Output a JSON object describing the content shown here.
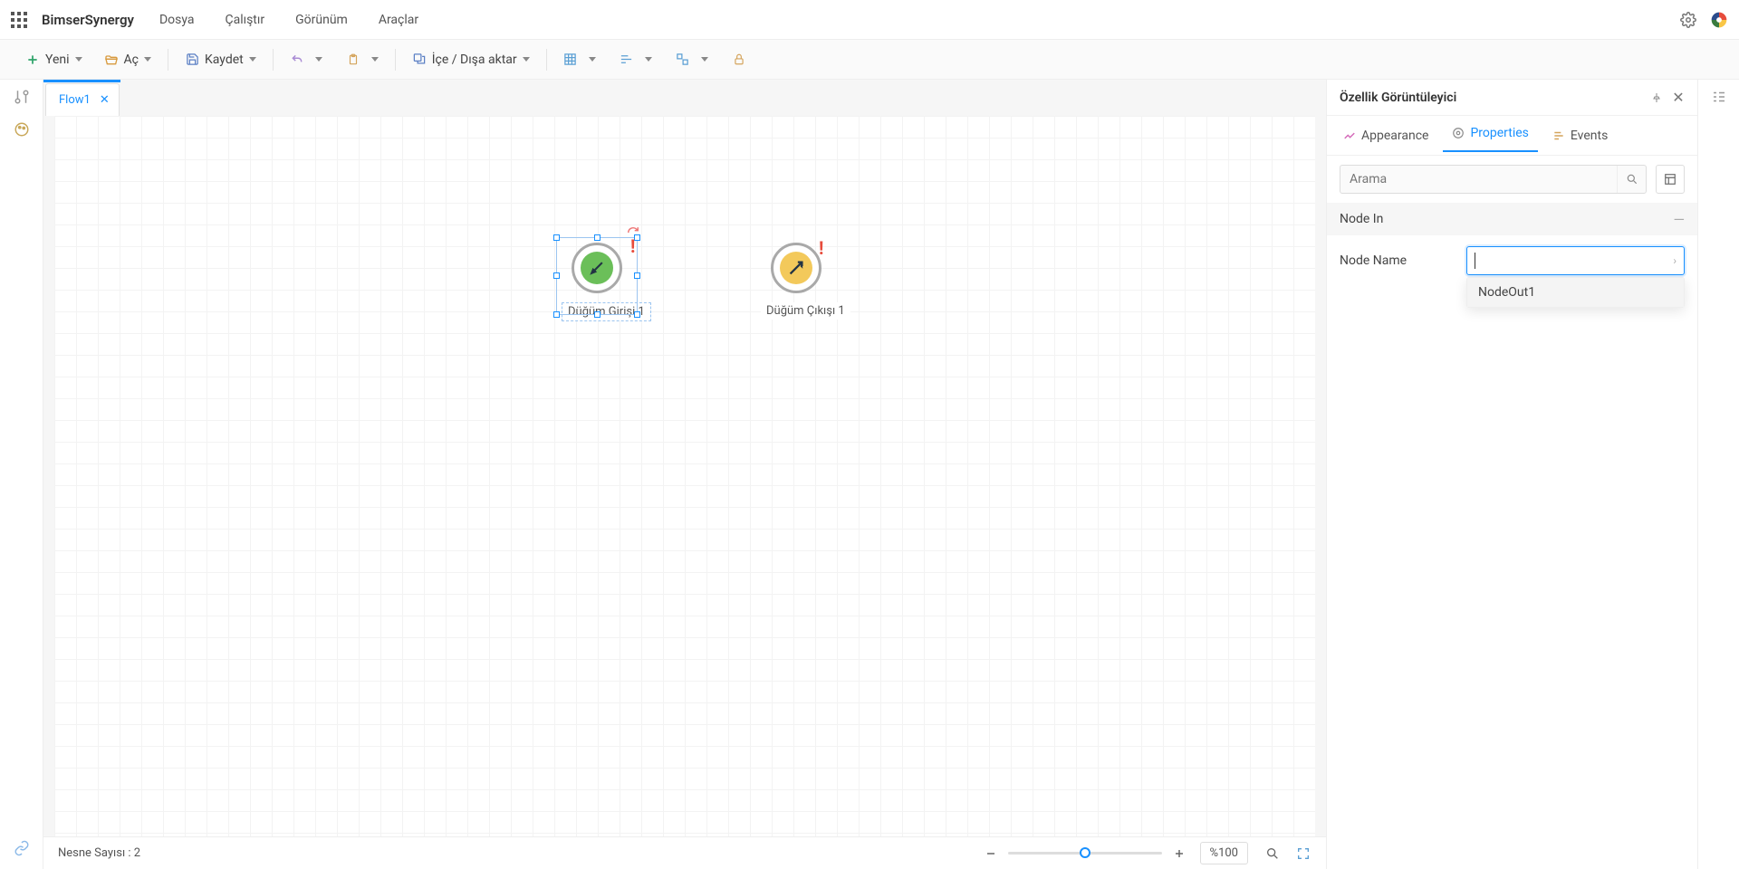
{
  "menubar": {
    "brand": "BimserSynergy",
    "items": [
      "Dosya",
      "Çalıştır",
      "Görünüm",
      "Araçlar"
    ]
  },
  "toolbar": {
    "new": "Yeni",
    "open": "Aç",
    "save": "Kaydet",
    "import_export": "İçe / Dışa aktar"
  },
  "tab": {
    "label": "Flow1"
  },
  "canvas": {
    "node_in": {
      "label": "Düğüm Girişi 1",
      "selected": true
    },
    "node_out": {
      "label": "Düğüm Çıkışı 1"
    }
  },
  "status": {
    "object_count_label": "Nesne Sayısı : 2",
    "zoom_value": "%100",
    "zoom_pos_pct": 50
  },
  "panel": {
    "title": "Özellik Görüntüleyici",
    "tabs": {
      "appearance": "Appearance",
      "properties": "Properties",
      "events": "Events"
    },
    "search_placeholder": "Arama",
    "section": "Node In",
    "prop_label": "Node Name",
    "prop_value": "",
    "dropdown_option": "NodeOut1"
  }
}
